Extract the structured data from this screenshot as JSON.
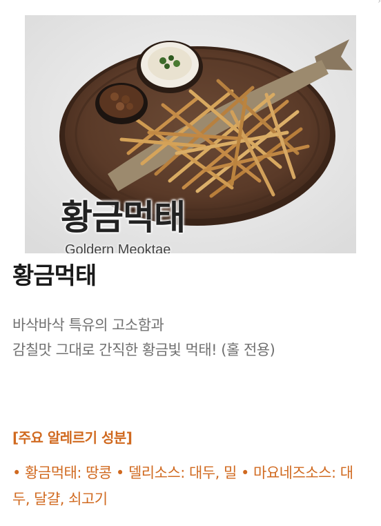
{
  "product": {
    "image_caption_ko": "황금먹태",
    "image_caption_en": "Goldern Meoktae",
    "name": "황금먹태",
    "description_line1": "바삭바삭 특유의 고소함과",
    "description_line2": "감칠맛 그대로 간직한 황금빛 먹태! (홀 전용)"
  },
  "allergens": {
    "heading": "[주요 알레르기 성분]",
    "text": "• 황금먹태: 땅콩 • 델리소스: 대두, 밀 • 마요네즈소스: 대두, 달걀, 쇠고기"
  },
  "colors": {
    "accent": "#d0691f",
    "title": "#1a1a1a",
    "description": "#707070"
  },
  "icons": {
    "corner": "chevron-right-icon"
  }
}
